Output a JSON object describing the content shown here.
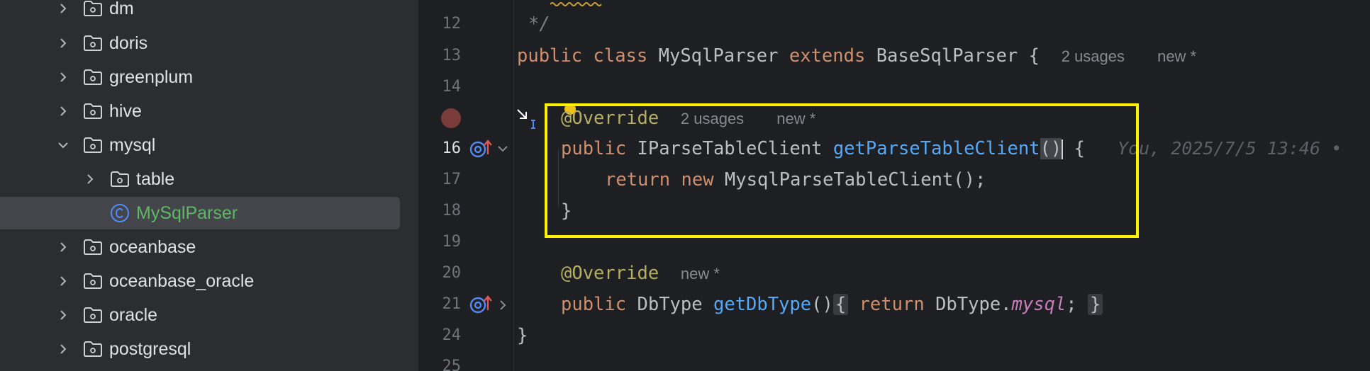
{
  "tree": {
    "items": [
      {
        "label": "dm",
        "expanded": false,
        "type": "package"
      },
      {
        "label": "doris",
        "expanded": false,
        "type": "package"
      },
      {
        "label": "greenplum",
        "expanded": false,
        "type": "package"
      },
      {
        "label": "hive",
        "expanded": false,
        "type": "package"
      },
      {
        "label": "mysql",
        "expanded": true,
        "type": "package"
      },
      {
        "label": "table",
        "expanded": false,
        "type": "package"
      },
      {
        "label": "MySqlParser",
        "type": "class",
        "selected": true
      },
      {
        "label": "oceanbase",
        "expanded": false,
        "type": "package"
      },
      {
        "label": "oceanbase_oracle",
        "expanded": false,
        "type": "package"
      },
      {
        "label": "oracle",
        "expanded": false,
        "type": "package"
      },
      {
        "label": "postgresql",
        "expanded": false,
        "type": "package"
      }
    ]
  },
  "editor": {
    "line_numbers": [
      "12",
      "13",
      "14",
      "16",
      "17",
      "18",
      "19",
      "20",
      "21",
      "24",
      "25"
    ],
    "comment_end": "*/",
    "class_decl": {
      "kw1": "public",
      "kw2": "class",
      "name": "MySqlParser",
      "kw3": "extends",
      "base": "BaseSqlParser",
      "brace": "{",
      "usages": "2 usages",
      "new": "new *"
    },
    "method1": {
      "annotation": "@Override",
      "usages": "2 usages",
      "new": "new *",
      "kw": "public",
      "type": "IParseTableClient",
      "name": "getParseTableClient",
      "parens": "()",
      "brace": "{",
      "blame": "You, 2025/7/5 13:46 •",
      "return_kw": "return",
      "new_kw": "new",
      "ctor": "MysqlParseTableClient();",
      "close": "}"
    },
    "method2": {
      "annotation": "@Override",
      "new": "new *",
      "kw": "public",
      "type": "DbType",
      "name": "getDbType",
      "parens": "()",
      "open": "{",
      "return_kw": "return",
      "qualifier": "DbType.",
      "field": "mysql",
      "semi": ";",
      "close": "}"
    },
    "class_close": "}"
  },
  "colors": {
    "sidebar_bg": "#2b2d30",
    "editor_bg": "#1e1f22",
    "keyword": "#cf8e6d",
    "function": "#56a8f5",
    "annotation": "#b3ae60",
    "highlight_box": "#fff200",
    "class_label": "#5fb865"
  }
}
